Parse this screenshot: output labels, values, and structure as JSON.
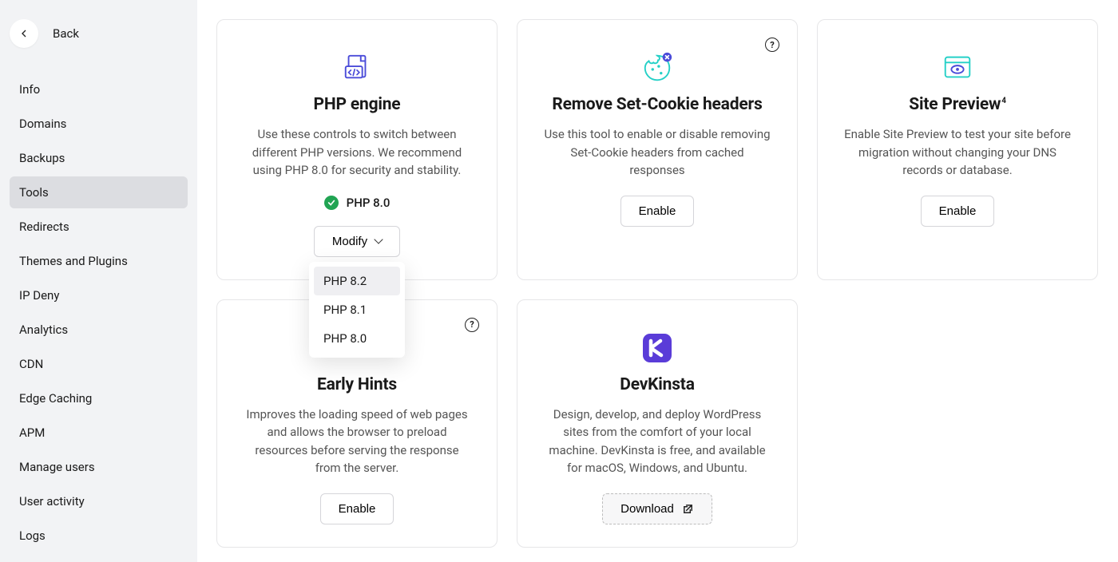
{
  "sidebar": {
    "back_label": "Back",
    "items": [
      {
        "label": "Info",
        "active": false
      },
      {
        "label": "Domains",
        "active": false
      },
      {
        "label": "Backups",
        "active": false
      },
      {
        "label": "Tools",
        "active": true
      },
      {
        "label": "Redirects",
        "active": false
      },
      {
        "label": "Themes and Plugins",
        "active": false
      },
      {
        "label": "IP Deny",
        "active": false
      },
      {
        "label": "Analytics",
        "active": false
      },
      {
        "label": "CDN",
        "active": false
      },
      {
        "label": "Edge Caching",
        "active": false
      },
      {
        "label": "APM",
        "active": false
      },
      {
        "label": "Manage users",
        "active": false
      },
      {
        "label": "User activity",
        "active": false
      },
      {
        "label": "Logs",
        "active": false
      }
    ]
  },
  "cards": {
    "php": {
      "title": "PHP engine",
      "desc": "Use these controls to switch between different PHP versions. We recommend using PHP 8.0 for security and stability.",
      "current_version": "PHP 8.0",
      "modify_label": "Modify",
      "options": [
        "PHP 8.2",
        "PHP 8.1",
        "PHP 8.0"
      ],
      "highlighted_index": 0,
      "icon_name": "php-file-icon",
      "icon_colors": {
        "primary": "#4b4cd9"
      }
    },
    "cookie": {
      "title": "Remove Set-Cookie headers",
      "desc": "Use this tool to enable or disable removing Set-Cookie headers from cached responses",
      "button": "Enable",
      "icon_name": "cookie-block-icon",
      "icon_colors": {
        "primary": "#25d0c7",
        "accent": "#4b4cd9"
      }
    },
    "preview": {
      "title": "Site Preview",
      "title_sup": "4",
      "desc": "Enable Site Preview to test your site before migration without changing your DNS records or database.",
      "button": "Enable",
      "icon_name": "eye-preview-icon",
      "icon_colors": {
        "primary": "#25d0c7"
      }
    },
    "hints": {
      "title": "Early Hints",
      "desc": "Improves the loading speed of web pages and allows the browser to preload resources before serving the response from the server.",
      "button": "Enable"
    },
    "devkinsta": {
      "title": "DevKinsta",
      "desc": "Design, develop, and deploy WordPress sites from the comfort of your local machine. DevKinsta is free, and available for macOS, Windows, and Ubuntu.",
      "button": "Download",
      "icon_name": "devkinsta-app-icon",
      "icon_colors": {
        "bg": "#5a3cd8",
        "fg": "#ffffff"
      }
    }
  }
}
